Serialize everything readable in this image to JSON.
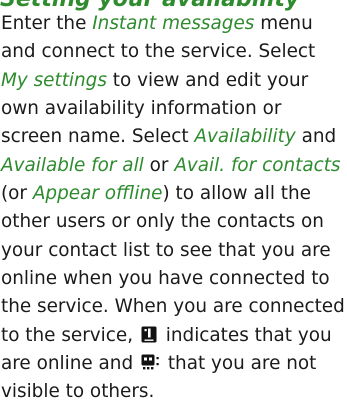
{
  "heading": "Setting your availability",
  "para": {
    "l1": {
      "t1": "Enter the ",
      "e1": "Instant messages",
      "t2": " menu"
    },
    "l2": {
      "t1": "and connect to the service. Select"
    },
    "l3": {
      "e1": "My settings",
      "t1": " to view and edit your"
    },
    "l4": {
      "t1": "own availability information or"
    },
    "l5": {
      "t1": "screen name. Select ",
      "e1": "Availability",
      "t2": " and"
    },
    "l6": {
      "e1": "Available for all",
      "t1": " or ",
      "e2": "Avail. for contacts"
    },
    "l7": {
      "t1": "(or ",
      "e1": "Appear offline",
      "t2": ") to allow all the"
    },
    "l8": {
      "t1": "other users or only the contacts on"
    },
    "l9": {
      "t1": "your contact list to see that you are"
    },
    "l10": {
      "t1": "online when you have connected to"
    },
    "l11": {
      "t1": "the service. When you are connected"
    },
    "l12": {
      "t1": "to the service, ",
      "t2": " indicates that you"
    },
    "l13": {
      "t1": "are online and ",
      "t2": " that you are not"
    },
    "l14": {
      "t1": "visible to others."
    }
  },
  "icons": {
    "online": "online-status-icon",
    "hidden": "hidden-status-icon"
  }
}
